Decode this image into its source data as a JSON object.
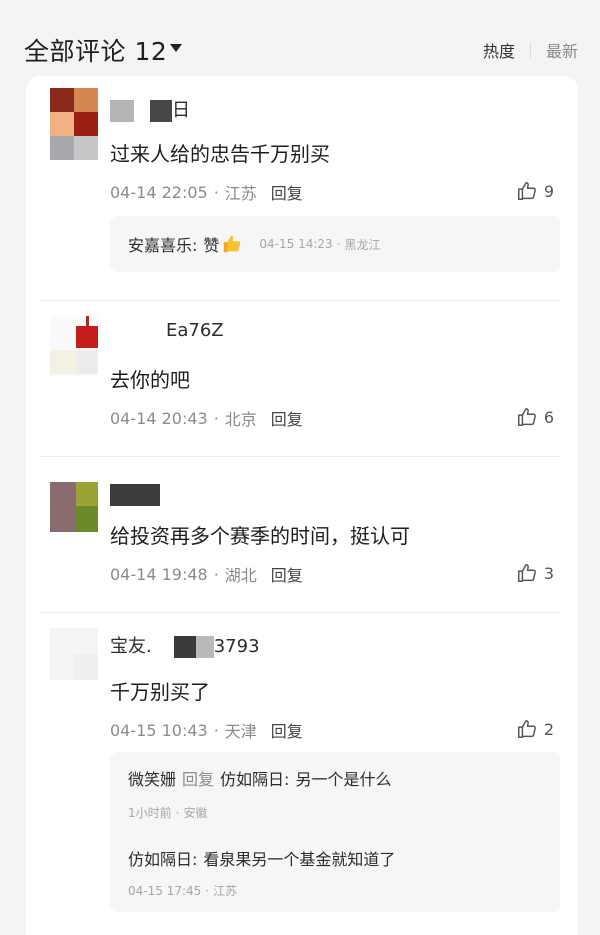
{
  "header": {
    "title": "全部评论 12",
    "sort_hot": "热度",
    "sort_new": "最新"
  },
  "comments": [
    {
      "user": "日",
      "text": "过来人给的忠告千万别买",
      "time": "04-14 22:05",
      "location": "江苏",
      "reply_label": "回复",
      "likes": "9",
      "replies": [
        {
          "name": "安嘉喜乐:",
          "text": "赞",
          "time": "04-15 14:23",
          "location": "黑龙江"
        }
      ]
    },
    {
      "user": "Ea76Z",
      "text": "去你的吧",
      "time": "04-14 20:43",
      "location": "北京",
      "reply_label": "回复",
      "likes": "6"
    },
    {
      "user": "",
      "text": "给投资再多个赛季的时间，挺认可",
      "time": "04-14 19:48",
      "location": "湖北",
      "reply_label": "回复",
      "likes": "3"
    },
    {
      "user_prefix": "宝友.",
      "user_suffix": "3793",
      "text": "千万别买了",
      "time": "04-15 10:43",
      "location": "天津",
      "reply_label": "回复",
      "likes": "2",
      "replies": [
        {
          "name": "微笑姗",
          "reply_word": "回复",
          "target": "仿如隔日:",
          "text": "另一个是什么",
          "time": "1小时前",
          "location": "安徽"
        },
        {
          "name": "仿如隔日:",
          "text": "看泉果另一个基金就知道了",
          "time": "04-15 17:45",
          "location": "江苏"
        }
      ]
    }
  ],
  "colors": {
    "background": "#f4f4f4",
    "card": "#ffffff",
    "reply_box": "#f6f6f6",
    "meta_text": "#8b8b8b"
  },
  "icons": [
    "caret-down-icon",
    "thumbs-up-icon",
    "thumbs-up-emoji-icon"
  ]
}
